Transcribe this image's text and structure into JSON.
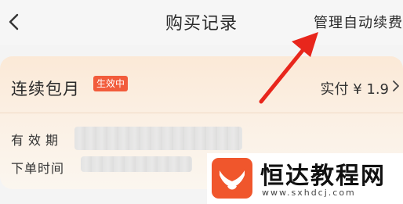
{
  "header": {
    "title": "购买记录",
    "manage_label": "管理自动续费"
  },
  "record": {
    "name": "连续包月",
    "status_badge": "生效中",
    "paid_label": "实付",
    "paid_amount": "¥ 1.9",
    "validity_label": "有效期",
    "order_time_label": "下单时间"
  },
  "watermark": {
    "brand": "恒达教程网",
    "url": "www.sxhdcj.com"
  },
  "colors": {
    "badge": "#f25c3c",
    "arrow": "#e8261c",
    "logo": "#f0562c"
  },
  "icons": {
    "back": "chevron-left-icon",
    "detail": "chevron-right-icon",
    "pointer": "red-arrow-annotation"
  }
}
